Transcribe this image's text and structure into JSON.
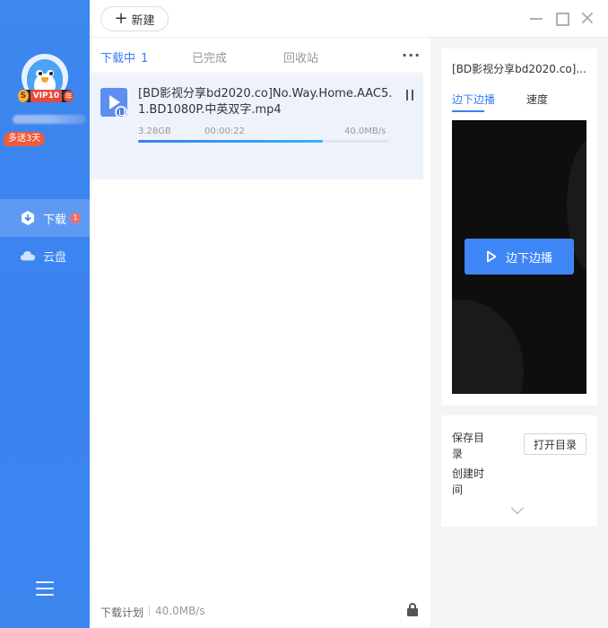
{
  "user": {
    "vip_label": "VIP10",
    "vip_year": "年",
    "vip_s": "S",
    "promo": "多送3天"
  },
  "sidebar": {
    "items": [
      {
        "label": "下载",
        "badge": "1",
        "icon": "download-icon"
      },
      {
        "label": "云盘",
        "icon": "cloud-icon"
      }
    ]
  },
  "toolbar": {
    "new_label": "新建"
  },
  "tabs": [
    {
      "label": "下载中",
      "count": "1"
    },
    {
      "label": "已完成"
    },
    {
      "label": "回收站"
    }
  ],
  "more": "···",
  "downloads": [
    {
      "name": "[BD影视分享bd2020.co]No.Way.Home.AAC5.1.BD1080P.中英双字.mp4",
      "size": "3.28GB",
      "time": "00:00:22",
      "speed": "40.0MB/s",
      "progress": 0.735
    }
  ],
  "bottom": {
    "plan_label": "下载计划",
    "speed": "40.0MB/s"
  },
  "panel": {
    "title": "[BD影视分享bd2020.co]...",
    "tabs": [
      "边下边播",
      "速度"
    ],
    "play_label": "边下边播",
    "save_dir_label": "保存目录",
    "create_time_label": "创建时间",
    "open_dir_label": "打开目录"
  },
  "colors": {
    "accent": "#3a7ff0",
    "sidebar": "#3b82f1",
    "badge": "#f36b6b"
  }
}
